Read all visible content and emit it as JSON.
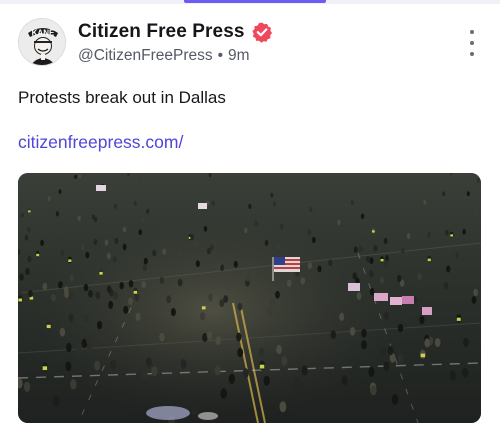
{
  "post": {
    "author": {
      "display_name": "Citizen Free Press",
      "handle": "@CitizenFreePress",
      "separator": "•",
      "time": "9m",
      "avatar_text": "KANE",
      "verified_color": "#f0475d"
    },
    "text": "Protests break out in Dallas",
    "link": "citizenfreepress.com/",
    "link_color": "#4f46d6",
    "media": {
      "type": "aerial-night-photo"
    }
  },
  "icons": {
    "verified": "verified-badge-icon",
    "more": "more-vertical-icon"
  },
  "colors": {
    "accent": "#6b5cf5",
    "text": "#16181d",
    "muted": "#555a66"
  }
}
